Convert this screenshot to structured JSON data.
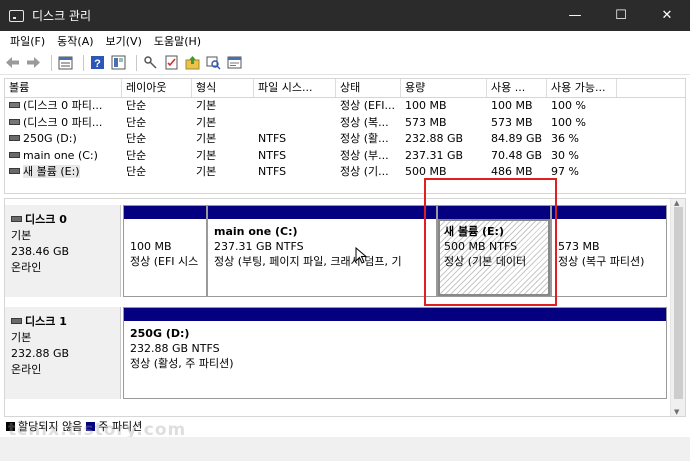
{
  "window": {
    "title": "디스크 관리",
    "minimize": "—",
    "maximize": "☐",
    "close": "✕"
  },
  "menu": [
    "파일(F)",
    "동작(A)",
    "보기(V)",
    "도움말(H)"
  ],
  "toolbar": {
    "icons": [
      "back-arrow-icon",
      "forward-arrow-icon",
      "properties-icon",
      "help-icon",
      "view-icon",
      "key-icon",
      "checklist-icon",
      "folder-up-icon",
      "search-icon",
      "console-icon"
    ]
  },
  "volume_list": {
    "columns": [
      "볼륨",
      "레이아웃",
      "형식",
      "파일 시스...",
      "상태",
      "용량",
      "사용 ...",
      "사용 가능..."
    ],
    "rows": [
      [
        "(디스크 0 파티...",
        "단순",
        "기본",
        "",
        "정상 (EFI...",
        "100 MB",
        "100 MB",
        "100 %"
      ],
      [
        "(디스크 0 파티...",
        "단순",
        "기본",
        "",
        "정상 (복...",
        "573 MB",
        "573 MB",
        "100 %"
      ],
      [
        "250G (D:)",
        "단순",
        "기본",
        "NTFS",
        "정상 (활...",
        "232.88 GB",
        "84.89 GB",
        "36 %"
      ],
      [
        "main one (C:)",
        "단순",
        "기본",
        "NTFS",
        "정상 (부...",
        "237.31 GB",
        "70.48 GB",
        "30 %"
      ],
      [
        "새 볼륨 (E:)",
        "단순",
        "기본",
        "NTFS",
        "정상 (기...",
        "500 MB",
        "486 MB",
        "97 %"
      ]
    ]
  },
  "disks": [
    {
      "name": "디스크 0",
      "kind": "기본",
      "size": "238.46 GB",
      "state": "온라인",
      "partitions": [
        {
          "title": "",
          "size": "100 MB",
          "status": "정상 (EFI 시스"
        },
        {
          "title": "main one  (C:)",
          "size": "237.31 GB NTFS",
          "status": "정상 (부팅, 페이지 파일, 크래시 덤프, 기"
        },
        {
          "title": "새 볼륨  (E:)",
          "size": "500 MB NTFS",
          "status": "정상 (기본 데이터"
        },
        {
          "title": "",
          "size": "573 MB",
          "status": "정상 (복구 파티션)"
        }
      ]
    },
    {
      "name": "디스크 1",
      "kind": "기본",
      "size": "232.88 GB",
      "state": "온라인",
      "partitions": [
        {
          "title": "250G  (D:)",
          "size": "232.88 GB NTFS",
          "status": "정상 (활성, 주 파티션)"
        }
      ]
    }
  ],
  "legend": [
    {
      "label": "할당되지 않음",
      "color": "#000000"
    },
    {
      "label": "주 파티션",
      "color": "#040080"
    }
  ],
  "watermark": "tcnix.tistory.com",
  "colors": {
    "titlebar": "#2b2b2b",
    "partition_bar": "#040080",
    "selection": "#e02020"
  }
}
